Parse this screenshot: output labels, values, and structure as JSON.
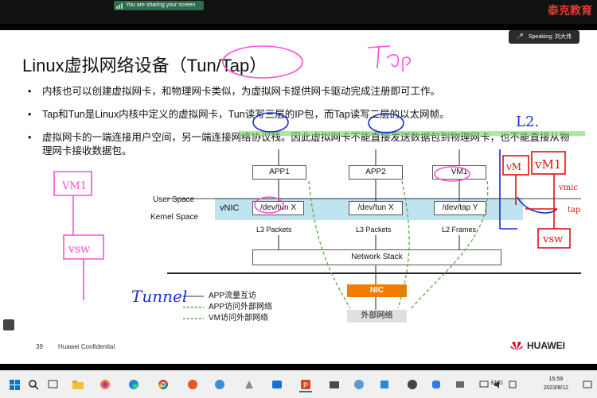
{
  "top_bar": {
    "share_banner": "You are sharing your screen",
    "brand": "泰克教育"
  },
  "slide": {
    "speaking": "Speaking: 刘大伟",
    "title": "Linux虚拟网络设备（Tun/Tap）",
    "bullets": [
      "内核也可以创建虚拟网卡，和物理网卡类似，为虚拟网卡提供网卡驱动完成注册即可工作。",
      "Tap和Tun是Linux内核中定义的虚拟网卡，Tun读写三层的IP包，而Tap读写二层的以太网帧。",
      "虚拟网卡的一端连接用户空间，另一端连接网络协议栈。因此虚拟网卡不能直接发送数据包到物理网卡，也不能直接从物理网卡接收数据包。"
    ],
    "diagram": {
      "apps": [
        "APP1",
        "APP2",
        "VM1"
      ],
      "user_space": "User Space",
      "kernel_space": "Kernel Space",
      "vnic": "vNIC",
      "devs": [
        "/dev/tun X",
        "/dev/tun X",
        "/dev/tap Y"
      ],
      "packets": [
        "L3 Packets",
        "L3 Packets",
        "L2 Frames"
      ],
      "network_stack": "Network Stack",
      "nic": "NIC",
      "wan": "外部网络",
      "legend": [
        "APP流量互访",
        "APP访问外部网络",
        "VM访问外部网络"
      ]
    },
    "footer": {
      "page": "39",
      "confidential": "Huawei Confidential",
      "logo": "HUAWEI"
    }
  },
  "annotations": [
    "Tap",
    "L2.",
    "VM1",
    "vsw",
    "Tunnel",
    "vM",
    "vmic",
    "tap"
  ],
  "taskbar": {
    "lang": "ENG",
    "time": "15:59",
    "date": "2023/8/12"
  },
  "colors": {
    "accent_red": "#e53935",
    "nic_orange": "#f07d00",
    "vnic_band": "#bfe3ef",
    "ink_pink": "#ff4fd8",
    "ink_blue": "#1a2fd0",
    "ink_green": "#7ad66a",
    "ink_red": "#e01010"
  }
}
